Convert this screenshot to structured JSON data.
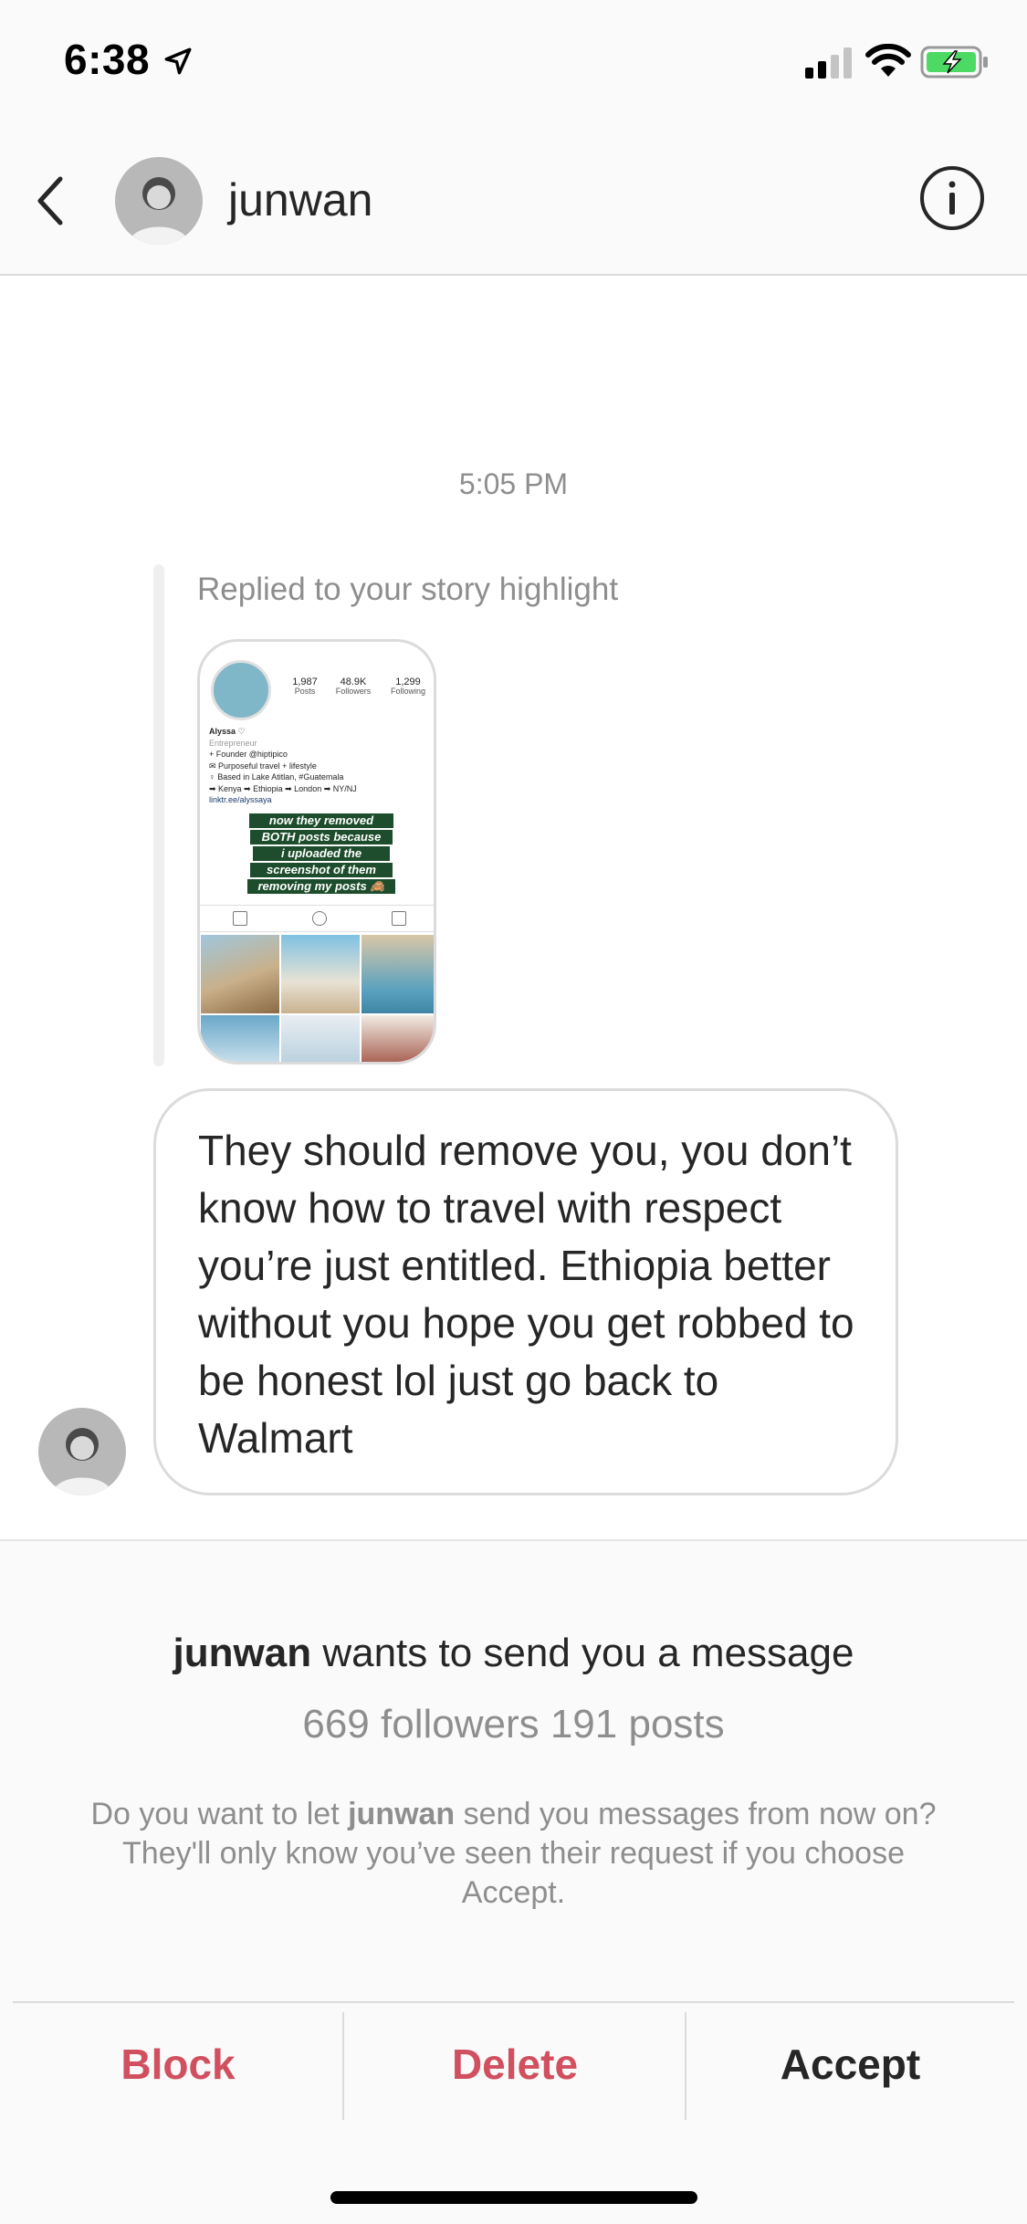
{
  "status_bar": {
    "time": "6:38",
    "icons": [
      "location-arrow-icon",
      "cellular-signal-icon",
      "wifi-icon",
      "battery-charging-icon"
    ],
    "battery_color": "#4cd964"
  },
  "header": {
    "username": "junwan",
    "back_icon": "chevron-left-icon",
    "info_icon": "info-circle-icon"
  },
  "conversation": {
    "timestamp": "5:05 PM",
    "story_reply_label": "Replied to your story highlight",
    "story_thumbnail": {
      "posts": "1,987",
      "posts_label": "Posts",
      "followers": "48.9K",
      "followers_label": "Followers",
      "following": "1,299",
      "following_label": "Following",
      "name": "Alyssa ♡",
      "category": "Entrepreneur",
      "bio_lines": [
        "+ Founder @hiptipico",
        "✉ Purposeful travel + lifestyle",
        "♀ Based in Lake Atitlan, #Guatemala",
        "➡ Kenya ➡ Ethiopia ➡ London ➡ NY/NJ"
      ],
      "link": "linktr.ee/alyssaya",
      "caption_lines": [
        "now they removed",
        "BOTH posts because",
        "i uploaded the",
        "screenshot of them",
        "removing my posts 🙈"
      ]
    },
    "message": "They should remove you, you don’t know how to travel with respect you’re just entitled. Ethiopia better without you hope you get robbed to be honest lol just go back to Walmart"
  },
  "request": {
    "username": "junwan",
    "title_suffix": " wants to send you a message",
    "stats": "669 followers 191 posts",
    "desc_prefix": "Do you want to let ",
    "desc_username": "junwan",
    "desc_suffix": " send you messages from now on? They'll only know you’ve seen their request if you choose Accept.",
    "actions": {
      "block": "Block",
      "delete": "Delete",
      "accept": "Accept"
    }
  },
  "colors": {
    "danger": "#d1505f",
    "text": "#262626",
    "muted": "#8e8e8e",
    "border": "#dbdbdb"
  }
}
